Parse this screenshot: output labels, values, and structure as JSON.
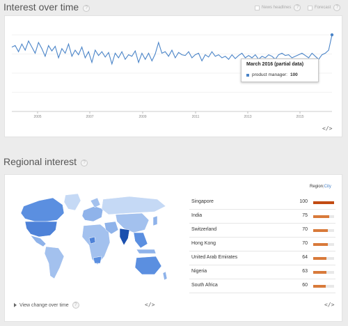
{
  "interest": {
    "title": "Interest over time",
    "help": "?",
    "options": [
      {
        "label": "News headlines",
        "help": "?"
      },
      {
        "label": "Forecast",
        "help": "?"
      }
    ],
    "tooltip": {
      "title": "March 2016 (partial data)",
      "series_label": "product manager:",
      "series_value": "100"
    },
    "embed": "</>"
  },
  "chart_data": {
    "type": "line",
    "x_ticks": [
      "2005",
      "2007",
      "2009",
      "2011",
      "2013",
      "2015"
    ],
    "series": [
      {
        "name": "product manager",
        "color": "#4a84c8",
        "x_range": [
          "2004-01",
          "2016-03"
        ],
        "values": [
          84,
          86,
          78,
          88,
          80,
          92,
          84,
          76,
          90,
          82,
          72,
          86,
          79,
          85,
          70,
          82,
          76,
          88,
          72,
          80,
          74,
          84,
          70,
          78,
          64,
          80,
          73,
          78,
          71,
          77,
          62,
          76,
          70,
          78,
          68,
          74,
          72,
          79,
          64,
          76,
          68,
          76,
          66,
          75,
          90,
          76,
          78,
          72,
          80,
          70,
          77,
          74,
          73,
          78,
          70,
          74,
          76,
          66,
          74,
          71,
          78,
          72,
          74,
          70,
          72,
          68,
          74,
          69,
          73,
          76,
          70,
          73,
          70,
          74,
          68,
          72,
          70,
          74,
          72,
          68,
          74,
          76,
          73,
          74,
          70,
          72,
          74,
          76,
          73,
          70,
          76,
          72,
          68,
          74,
          76,
          80,
          100
        ]
      }
    ],
    "highlight": {
      "label": "March 2016 (partial data)",
      "value": 100
    }
  },
  "regional": {
    "title": "Regional interest",
    "help": "?",
    "switch": {
      "region": "Region",
      "sep": "|",
      "city": "City"
    },
    "rows": [
      {
        "name": "Singapore",
        "value": 100
      },
      {
        "name": "India",
        "value": 75
      },
      {
        "name": "Switzerland",
        "value": 70
      },
      {
        "name": "Hong Kong",
        "value": 70
      },
      {
        "name": "United Arab Emirates",
        "value": 64
      },
      {
        "name": "Nigeria",
        "value": 63
      },
      {
        "name": "South Africa",
        "value": 60
      }
    ],
    "view_change": "View change over time",
    "view_change_help": "?",
    "map_embed": "</>",
    "list_embed": "</>"
  },
  "colors": {
    "line": "#4a84c8",
    "bar_top": "#c24b12",
    "bar": "#d87a3a",
    "map_dark": "#5b8fe0",
    "map_light": "#c5d9f5",
    "map_mid": "#a3c1ee"
  }
}
